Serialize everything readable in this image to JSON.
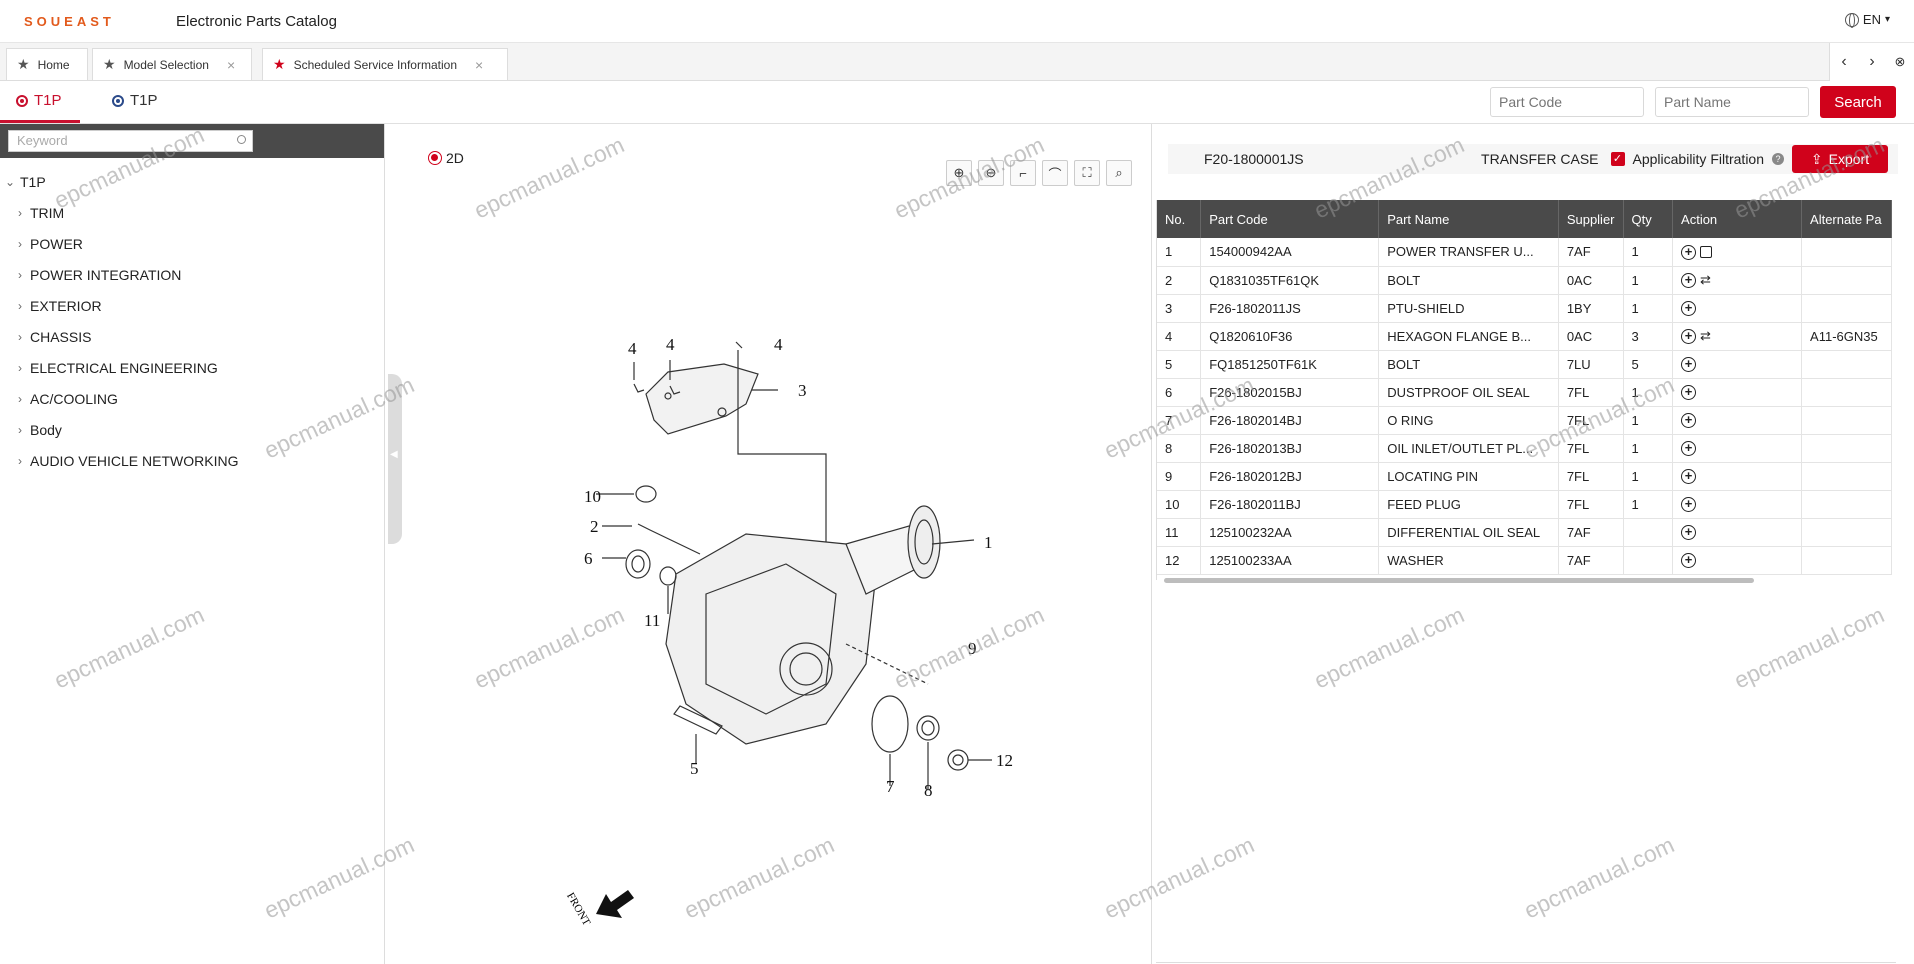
{
  "header": {
    "brand": "SOUEAST",
    "title": "Electronic Parts Catalog",
    "language": "EN"
  },
  "tabs": [
    {
      "label": "Home",
      "closable": false
    },
    {
      "label": "Model Selection",
      "closable": true
    },
    {
      "label": "Scheduled Service Information",
      "closable": true,
      "active": true
    }
  ],
  "subheader": {
    "tab1": "T1P",
    "tab2": "T1P",
    "part_code_placeholder": "Part Code",
    "part_name_placeholder": "Part Name",
    "search_label": "Search"
  },
  "sidebar": {
    "keyword_placeholder": "Keyword",
    "root": "T1P",
    "items": [
      "TRIM",
      "POWER",
      "POWER INTEGRATION",
      "EXTERIOR",
      "CHASSIS",
      "ELECTRICAL ENGINEERING",
      "AC/COOLING",
      "Body",
      "AUDIO VEHICLE NETWORKING"
    ]
  },
  "diagram": {
    "mode_label": "2D",
    "callouts": [
      "1",
      "2",
      "3",
      "4",
      "4",
      "4",
      "5",
      "6",
      "7",
      "8",
      "9",
      "10",
      "11",
      "12"
    ],
    "front_label": "FRONT"
  },
  "detail": {
    "part_id": "F20-1800001JS",
    "group_name": "TRANSFER CASE",
    "filter_label": "Applicability Filtration",
    "export_label": "Export"
  },
  "table": {
    "headers": [
      "No.",
      "Part Code",
      "Part Name",
      "Supplier",
      "Qty",
      "Action",
      "Alternate Pa"
    ],
    "rows": [
      {
        "no": "1",
        "code": "154000942AA",
        "name": "POWER TRANSFER U...",
        "supplier": "7AF",
        "qty": "1",
        "alt": ""
      },
      {
        "no": "2",
        "code": "Q1831035TF61QK",
        "name": "BOLT",
        "supplier": "0AC",
        "qty": "1",
        "alt": ""
      },
      {
        "no": "3",
        "code": "F26-1802011JS",
        "name": "PTU-SHIELD",
        "supplier": "1BY",
        "qty": "1",
        "alt": ""
      },
      {
        "no": "4",
        "code": "Q1820610F36",
        "name": "HEXAGON FLANGE B...",
        "supplier": "0AC",
        "qty": "3",
        "alt": "A11-6GN35"
      },
      {
        "no": "5",
        "code": "FQ1851250TF61K",
        "name": "BOLT",
        "supplier": "7LU",
        "qty": "5",
        "alt": ""
      },
      {
        "no": "6",
        "code": "F26-1802015BJ",
        "name": "DUSTPROOF OIL SEAL",
        "supplier": "7FL",
        "qty": "1",
        "alt": ""
      },
      {
        "no": "7",
        "code": "F26-1802014BJ",
        "name": "O RING",
        "supplier": "7FL",
        "qty": "1",
        "alt": ""
      },
      {
        "no": "8",
        "code": "F26-1802013BJ",
        "name": "OIL INLET/OUTLET PL...",
        "supplier": "7FL",
        "qty": "1",
        "alt": ""
      },
      {
        "no": "9",
        "code": "F26-1802012BJ",
        "name": "LOCATING PIN",
        "supplier": "7FL",
        "qty": "1",
        "alt": ""
      },
      {
        "no": "10",
        "code": "F26-1802011BJ",
        "name": "FEED PLUG",
        "supplier": "7FL",
        "qty": "1",
        "alt": ""
      },
      {
        "no": "11",
        "code": "125100232AA",
        "name": "DIFFERENTIAL OIL SEAL",
        "supplier": "7AF",
        "qty": "",
        "alt": ""
      },
      {
        "no": "12",
        "code": "125100233AA",
        "name": "WASHER",
        "supplier": "7AF",
        "qty": "",
        "alt": ""
      }
    ]
  },
  "watermark": "epcmanual.com",
  "colors": {
    "accent": "#d0021b",
    "header_dark": "#4a4a4a",
    "brand": "#e25a1c"
  }
}
